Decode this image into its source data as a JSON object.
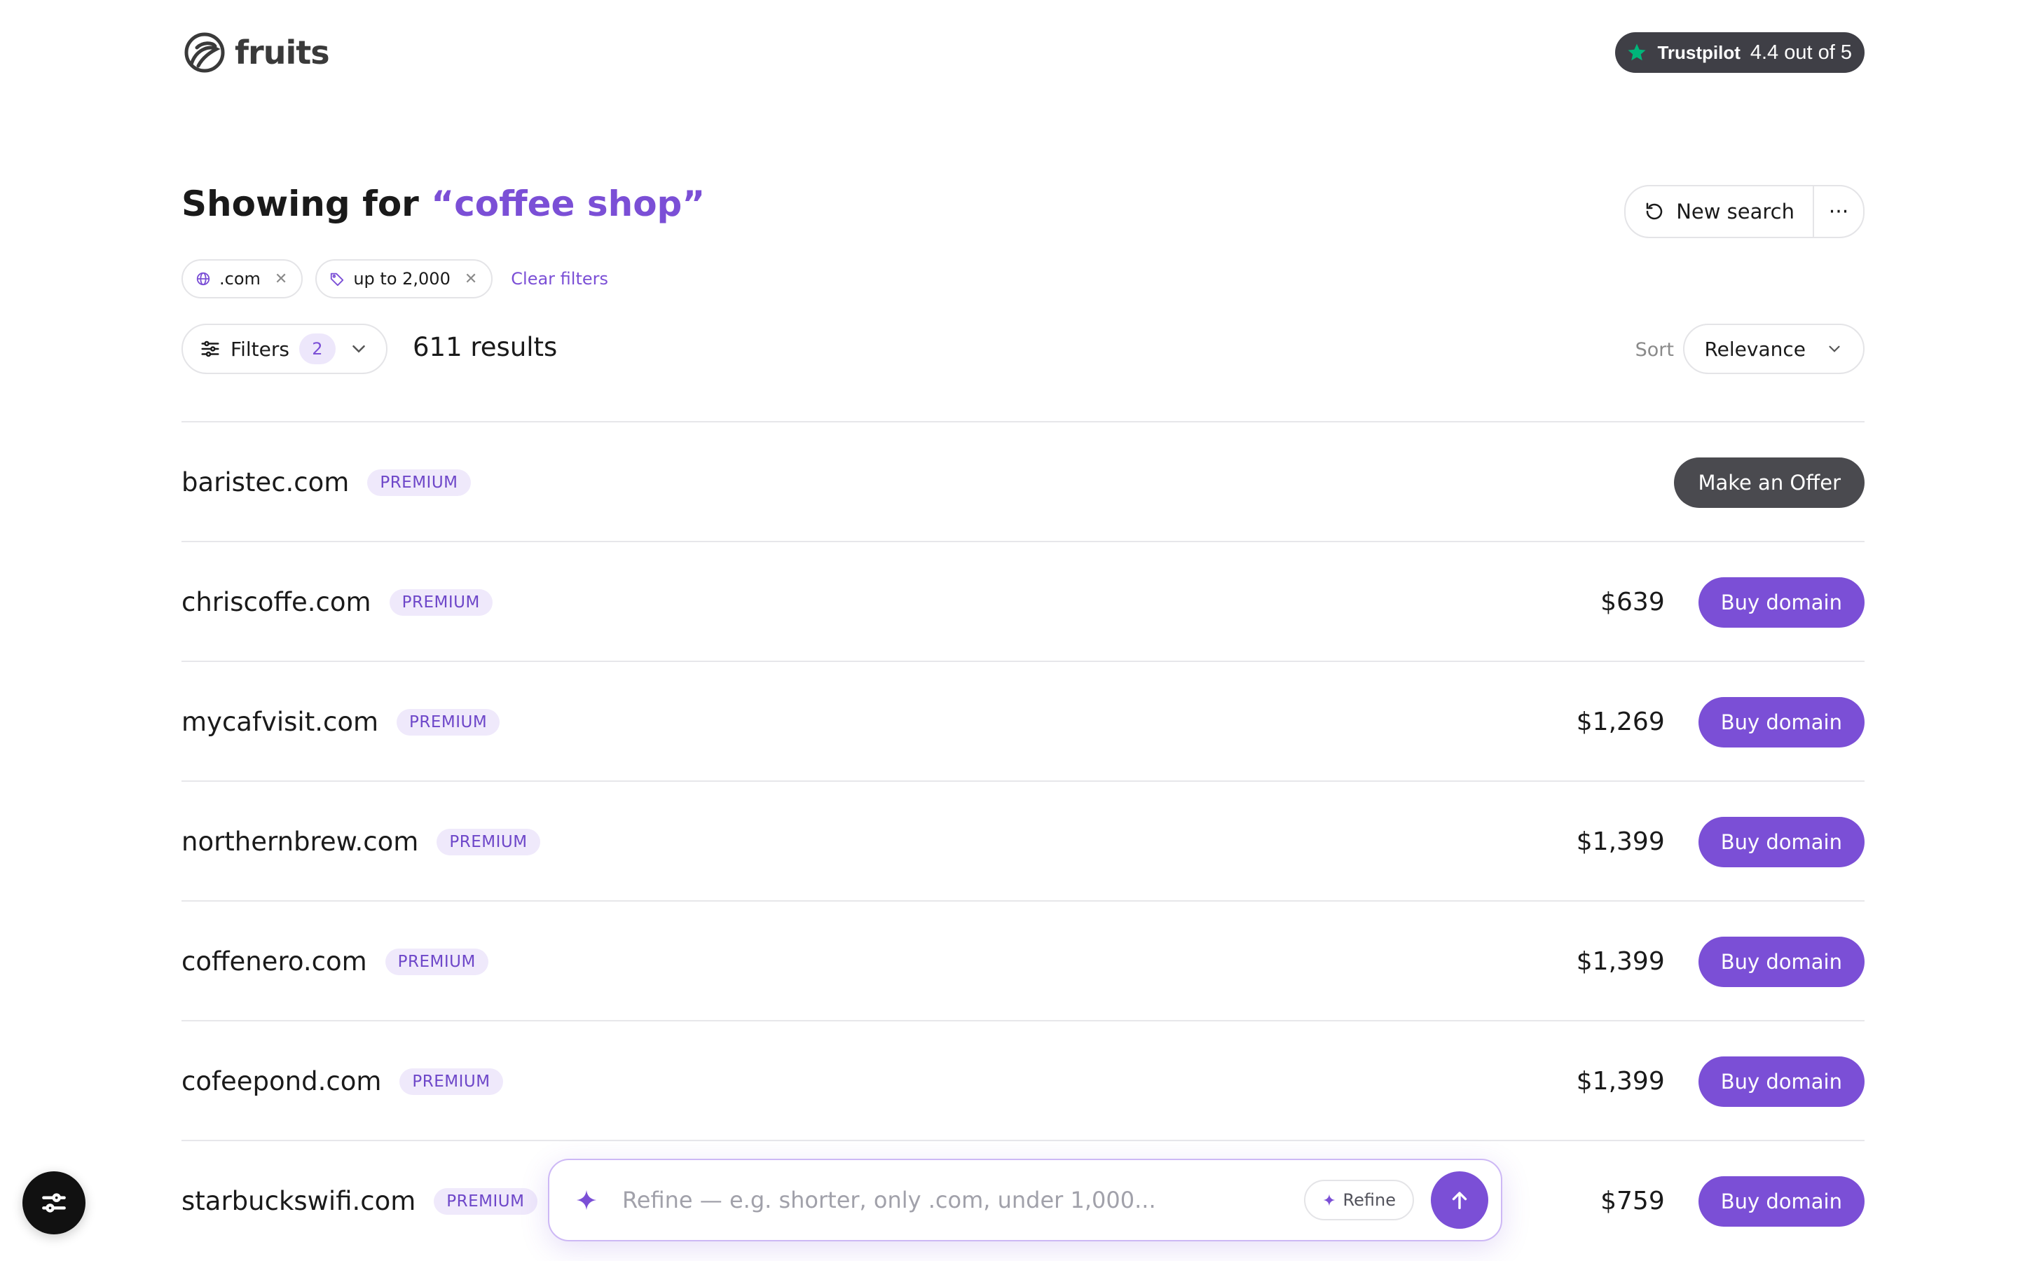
{
  "header": {
    "logo_text": "fruits",
    "trustpilot": {
      "brand": "Trustpilot",
      "rating": "4.4 out of 5"
    }
  },
  "title": {
    "prefix": "Showing for ",
    "query": "“coffee shop”"
  },
  "actions": {
    "new_search": "New search",
    "more": "···"
  },
  "chips": [
    {
      "label": ".com",
      "icon": "globe-icon"
    },
    {
      "label": "up to 2,000",
      "icon": "tag-icon"
    }
  ],
  "clear_filters": "Clear filters",
  "filters": {
    "label": "Filters",
    "count": "2"
  },
  "results_count": "611 results",
  "sort": {
    "label": "Sort",
    "value": "Relevance"
  },
  "domains": [
    {
      "name": "baristec.com",
      "badge": "PREMIUM",
      "price": "",
      "action": "Make an Offer"
    },
    {
      "name": "chriscoffe.com",
      "badge": "PREMIUM",
      "price": "$639",
      "action": "Buy domain"
    },
    {
      "name": "mycafvisit.com",
      "badge": "PREMIUM",
      "price": "$1,269",
      "action": "Buy domain"
    },
    {
      "name": "northernbrew.com",
      "badge": "PREMIUM",
      "price": "$1,399",
      "action": "Buy domain"
    },
    {
      "name": "coffenero.com",
      "badge": "PREMIUM",
      "price": "$1,399",
      "action": "Buy domain"
    },
    {
      "name": "cofeepond.com",
      "badge": "PREMIUM",
      "price": "$1,399",
      "action": "Buy domain"
    },
    {
      "name": "starbuckswifi.com",
      "badge": "PREMIUM",
      "price": "$759",
      "action": "Buy domain"
    }
  ],
  "refine": {
    "placeholder": "Refine — e.g. shorter, only .com, under 1,000...",
    "button": "Refine"
  },
  "colors": {
    "accent": "#7b4fd6",
    "dark_button": "#4a4a4f",
    "trust_green": "#00b67a"
  }
}
